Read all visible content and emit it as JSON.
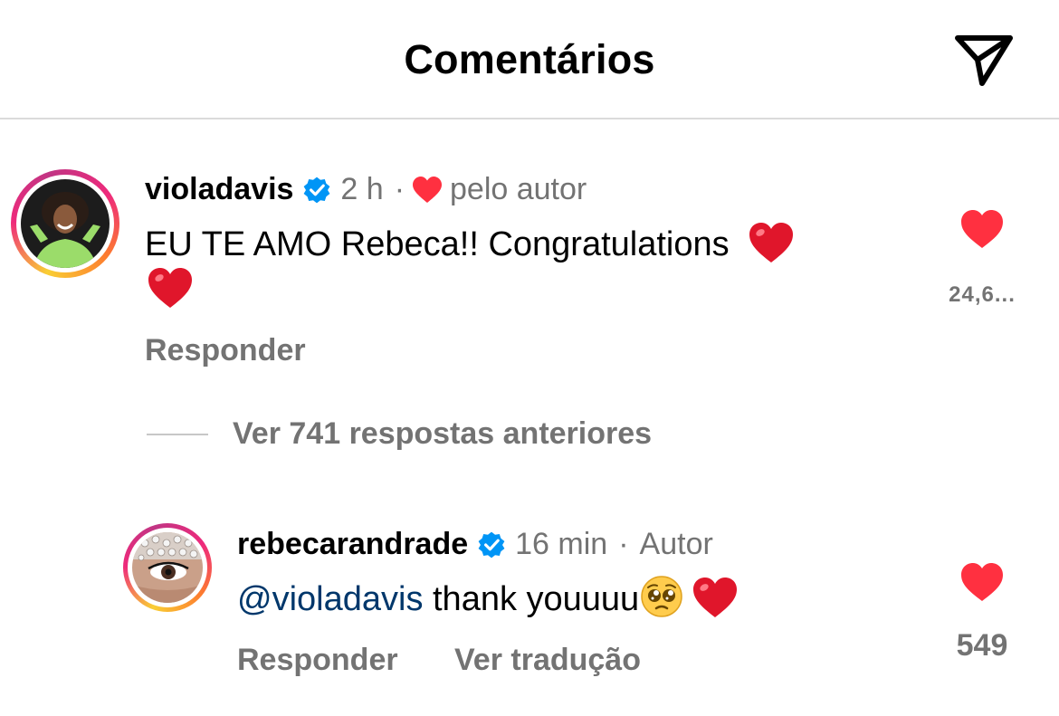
{
  "header": {
    "title": "Comentários",
    "share_icon": "paper-plane-icon"
  },
  "comments": [
    {
      "username": "violadavis",
      "verified": true,
      "time": "2 h",
      "separator": "·",
      "liked_by_author_label": "pelo autor",
      "text": "EU TE AMO Rebeca!! Congratulations",
      "emojis": [
        "red-heart",
        "red-heart"
      ],
      "reply_label": "Responder",
      "like_count": "24,6..."
    },
    {
      "username": "rebecarandrade",
      "verified": true,
      "time": "16 min",
      "separator": "·",
      "author_label": "Autor",
      "mention": "@violadavis",
      "text": "thank youuuu",
      "emojis": [
        "pleading-face",
        "red-heart"
      ],
      "reply_label": "Responder",
      "translate_label": "Ver tradução",
      "like_count": "549"
    }
  ],
  "view_replies_label": "Ver 741 respostas anteriores",
  "colors": {
    "heart": "#ff3040",
    "secondary_text": "#737373",
    "verified_blue": "#0095f6",
    "mention": "#00376b",
    "divider": "#dbdbdb"
  }
}
